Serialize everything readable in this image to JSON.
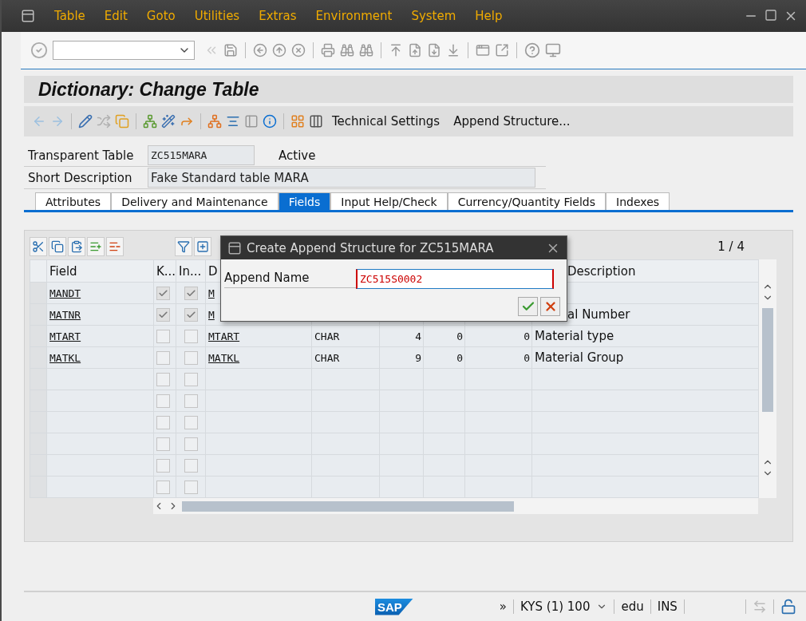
{
  "menu": [
    "Table",
    "Edit",
    "Goto",
    "Utilities",
    "Extras",
    "Environment",
    "System",
    "Help"
  ],
  "title": "Dictionary: Change Table",
  "app_toolbar": {
    "buttons": [
      "Technical Settings",
      "Append Structure..."
    ]
  },
  "header_fields": [
    {
      "label": "Transparent Table",
      "value": "ZC515MARA",
      "status": "Active"
    },
    {
      "label": "Short Description",
      "value": "Fake Standard table MARA"
    }
  ],
  "tabs": [
    {
      "label": "Attributes",
      "selected": false
    },
    {
      "label": "Delivery and Maintenance",
      "selected": false
    },
    {
      "label": "Fields",
      "selected": true
    },
    {
      "label": "Input Help/Check",
      "selected": false
    },
    {
      "label": "Currency/Quantity Fields",
      "selected": false
    },
    {
      "label": "Indexes",
      "selected": false
    }
  ],
  "fields_table": {
    "page": "1 / 4",
    "columns": [
      {
        "label": "Field",
        "covered": false
      },
      {
        "label": "K...",
        "covered": false
      },
      {
        "label": "In...",
        "covered": false
      },
      {
        "label": "D",
        "covered": false
      },
      {
        "label": "Description",
        "covered": true
      }
    ],
    "rows": [
      {
        "field": "MANDT",
        "key": true,
        "initial": true,
        "data_element": "M"
      },
      {
        "field": "MATNR",
        "key": true,
        "initial": true,
        "data_element": "M",
        "description": "al Number",
        "description_covered": true
      },
      {
        "field": "MTART",
        "key": false,
        "initial": false,
        "data_element": "MTART",
        "data_type": "CHAR",
        "length": "4",
        "decimals": "0",
        "column_8": "0",
        "description": "Material type",
        "description_covered": false
      },
      {
        "field": "MATKL",
        "key": false,
        "initial": false,
        "data_element": "MATKL",
        "data_type": "CHAR",
        "length": "9",
        "decimals": "0",
        "column_8": "0",
        "description": "Material Group",
        "description_covered": false
      },
      {
        "key": false,
        "initial": false
      },
      {
        "key": false,
        "initial": false
      },
      {
        "key": false,
        "initial": false
      },
      {
        "key": false,
        "initial": false
      },
      {
        "key": false,
        "initial": false
      },
      {
        "key": false,
        "initial": false
      }
    ]
  },
  "dialog": {
    "title": "Create Append Structure for ZC515MARA",
    "label": "Append Name",
    "value": "ZC515S0002"
  },
  "status_bar": {
    "logo": "SAP",
    "expand": "»",
    "system": "KYS (1) 100",
    "user": "edu",
    "mode": "INS"
  }
}
